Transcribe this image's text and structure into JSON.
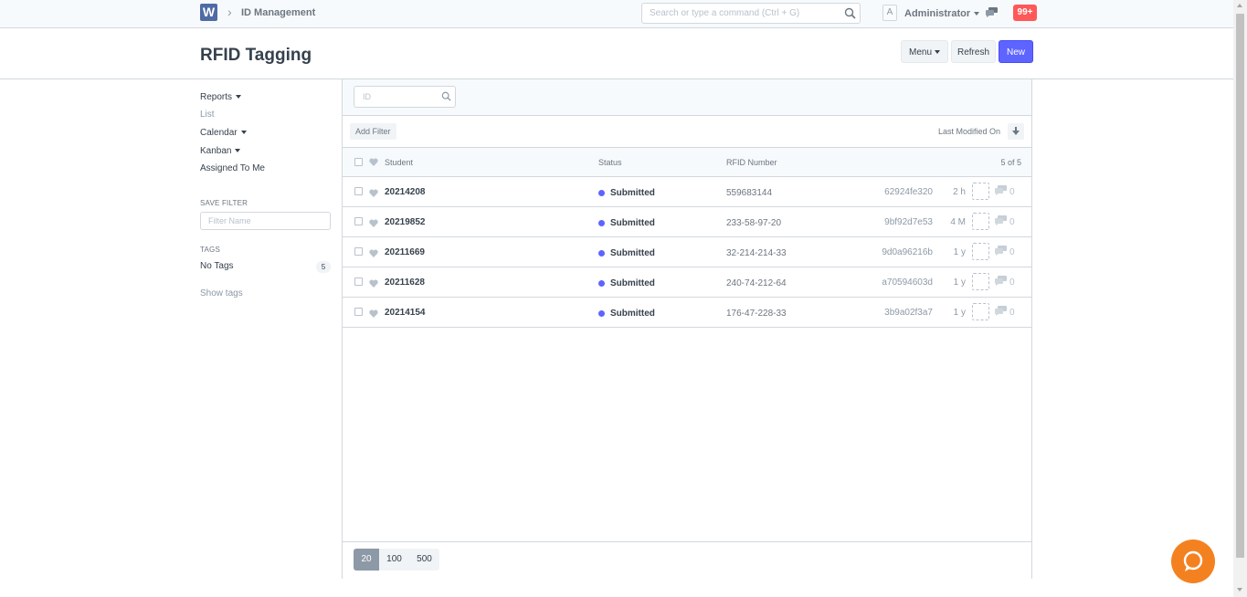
{
  "navbar": {
    "logo_letter": "W",
    "breadcrumb": "ID Management",
    "search_placeholder": "Search or type a command (Ctrl + G)",
    "avatar_letter": "A",
    "user_name": "Administrator",
    "notifications": "99+"
  },
  "page": {
    "title": "RFID Tagging",
    "menu_label": "Menu",
    "refresh_label": "Refresh",
    "new_label": "New"
  },
  "sidebar": {
    "reports": "Reports",
    "list": "List",
    "calendar": "Calendar",
    "kanban": "Kanban",
    "assigned": "Assigned To Me",
    "save_filter_heading": "SAVE FILTER",
    "filter_placeholder": "Filter Name",
    "tags_heading": "TAGS",
    "no_tags": "No Tags",
    "no_tags_count": "5",
    "show_tags": "Show tags"
  },
  "list": {
    "id_placeholder": "ID",
    "add_filter": "Add Filter",
    "sort_label": "Last Modified On",
    "columns": {
      "student": "Student",
      "status": "Status",
      "rfid": "RFID Number"
    },
    "count": "5 of 5",
    "rows": [
      {
        "student": "20214208",
        "status": "Submitted",
        "rfid": "559683144",
        "name": "62924fe320",
        "time": "2 h",
        "comments": "0"
      },
      {
        "student": "20219852",
        "status": "Submitted",
        "rfid": "233-58-97-20",
        "name": "9bf92d7e53",
        "time": "4 M",
        "comments": "0"
      },
      {
        "student": "20211669",
        "status": "Submitted",
        "rfid": "32-214-214-33",
        "name": "9d0a96216b",
        "time": "1 y",
        "comments": "0"
      },
      {
        "student": "20211628",
        "status": "Submitted",
        "rfid": "240-74-212-64",
        "name": "a70594603d",
        "time": "1 y",
        "comments": "0"
      },
      {
        "student": "20214154",
        "status": "Submitted",
        "rfid": "176-47-228-33",
        "name": "3b9a02f3a7",
        "time": "1 y",
        "comments": "0"
      }
    ],
    "page_sizes": [
      "20",
      "100",
      "500"
    ]
  },
  "colors": {
    "primary": "#5e64ff",
    "fab": "#f48120",
    "notif": "#ff5858"
  }
}
